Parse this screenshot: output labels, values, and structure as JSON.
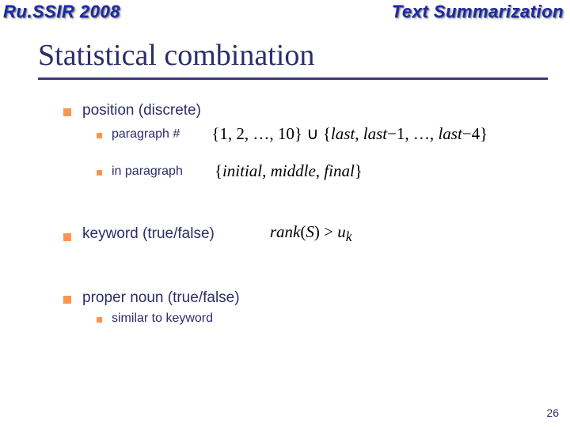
{
  "header": {
    "left": "Ru.SSIR 2008",
    "right": "Text Summarization"
  },
  "title": "Statistical combination",
  "items": {
    "position": {
      "label": "position (discrete)",
      "paragraph_num": {
        "label": "paragraph #",
        "formula": "{1, 2, …, 10} ∪ {last, last−1, …, last−4}"
      },
      "in_paragraph": {
        "label": "in paragraph",
        "formula": "{initial, middle, final}"
      }
    },
    "keyword": {
      "label": "keyword (true/false)",
      "formula": "rank(S) > uₖ"
    },
    "proper_noun": {
      "label": "proper noun (true/false)",
      "sub": {
        "label": "similar to keyword"
      }
    }
  },
  "page_number": "26"
}
